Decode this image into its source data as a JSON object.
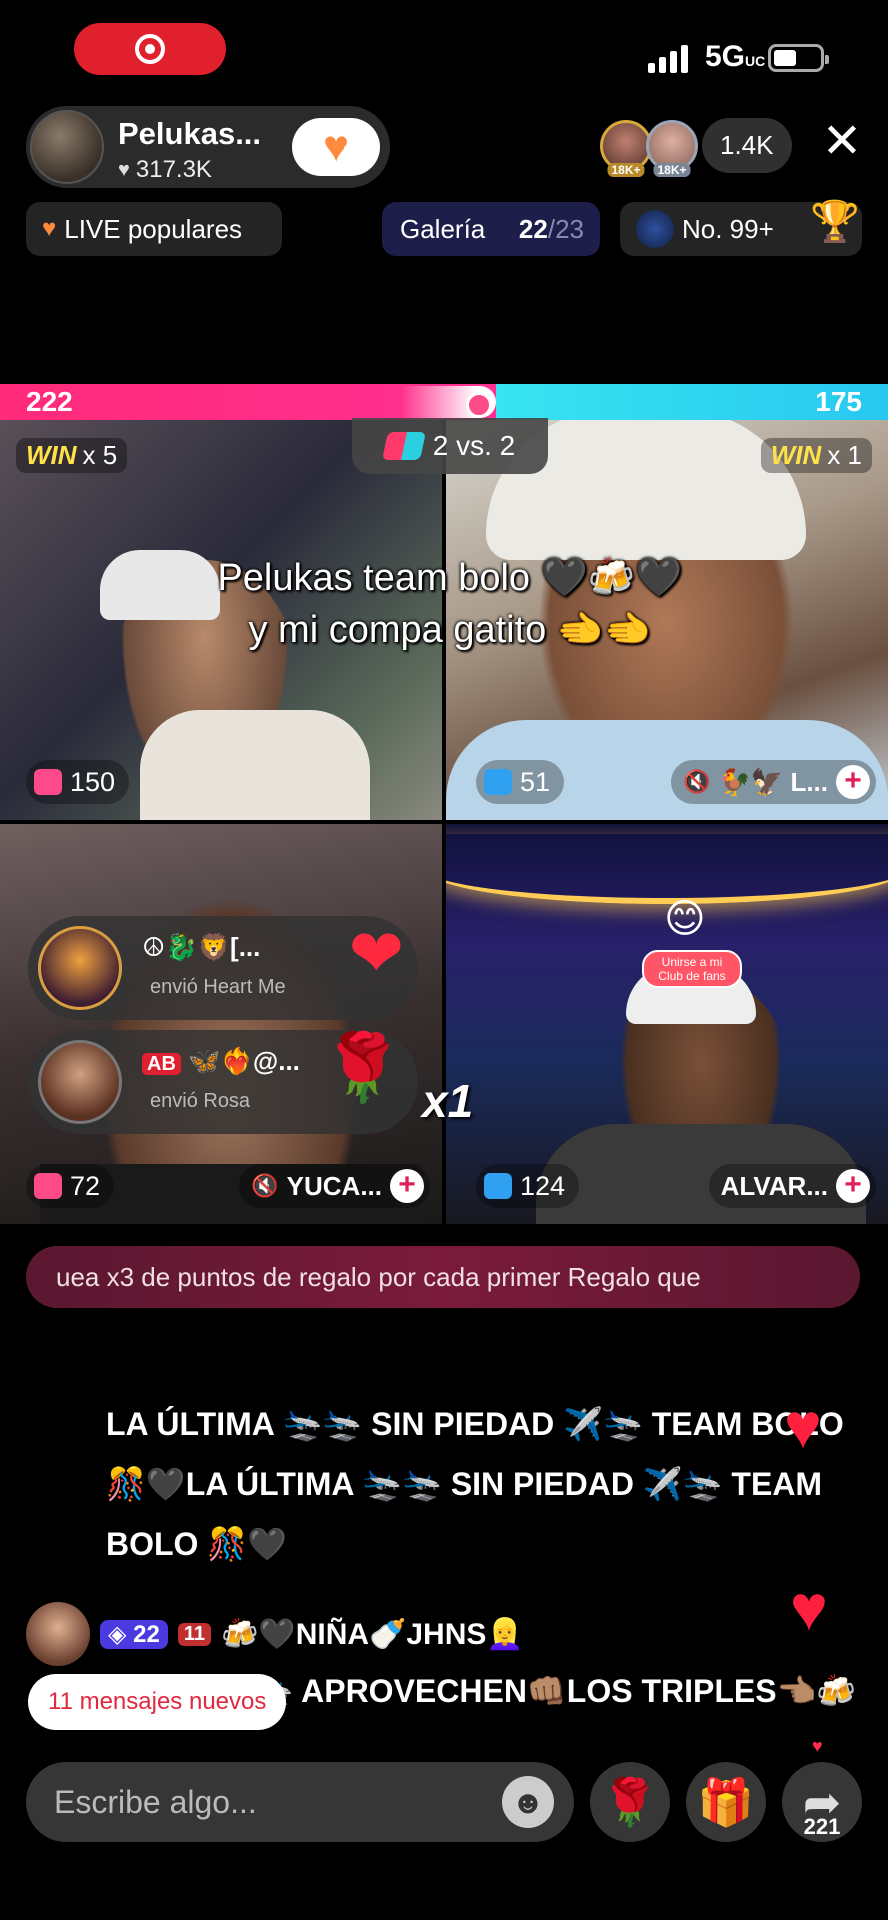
{
  "status": {
    "network": "5G",
    "network_sub": "UC"
  },
  "host": {
    "name": "Pelukas...",
    "likes": "317.3K",
    "follow_badge": "1"
  },
  "viewers": {
    "badge_1": "18K+",
    "badge_2": "18K+",
    "count": "1.4K"
  },
  "chips": {
    "live_popular": "LIVE populares",
    "gallery_label": "Galería",
    "gallery_current": "22",
    "gallery_total": "/23",
    "rank": "No. 99+"
  },
  "battle": {
    "left_score": "222",
    "right_score": "175",
    "left_ratio": 0.559,
    "vs_label": "2 vs. 2"
  },
  "overlay_text": {
    "line1": "Pelukas team bolo 🖤🍻🖤",
    "line2": "y mi compa gatito 🫲🫲"
  },
  "tiles": [
    {
      "win_word": "WIN",
      "win_count": "x 5",
      "score": "150"
    },
    {
      "win_word": "WIN",
      "win_count": "x 1",
      "score": "51",
      "user": "🐓🦅 L..."
    },
    {
      "score": "72",
      "user": "YUCA..."
    },
    {
      "score": "124",
      "user": "ALVAR...",
      "club_badge": "Unirse a mi Club de fans"
    }
  ],
  "gift_notifications": [
    {
      "name": "☮🐉🦁[...",
      "action": "envió Heart Me",
      "gift_icon": "heart-gift-icon"
    },
    {
      "badge": "AB",
      "name": "🦋❤️‍🔥@...",
      "action": "envió Rosa",
      "gift_icon": "rose-gift-icon"
    }
  ],
  "gift_multiplier": "x1",
  "banner_text": "uea x3 de puntos de regalo por cada primer Regalo que",
  "chat": {
    "message_1": "LA ÚLTIMA 🛬🛬 SIN PIEDAD ✈️🛬 TEAM BOLO 🎊🖤LA ÚLTIMA 🛬🛬 SIN PIEDAD ✈️🛬 TEAM BOLO 🎊🖤",
    "user_2_level": "22",
    "user_2_fan": "11",
    "user_2_name": "🍻🖤NIÑA🍼JHNS👱‍♀️",
    "message_3": "UAAAOS 🛬 APROVECHEN👊🏽LOS TRIPLES👈🏽🍻"
  },
  "new_messages": "11 mensajes nuevos",
  "bottom": {
    "comment_placeholder": "Escribe algo...",
    "share_count": "221"
  },
  "colors": {
    "team_left": "#ff2a7a",
    "team_right": "#38e4f0",
    "win_gold": "#ffe14a",
    "rec_red": "#e0202d"
  }
}
